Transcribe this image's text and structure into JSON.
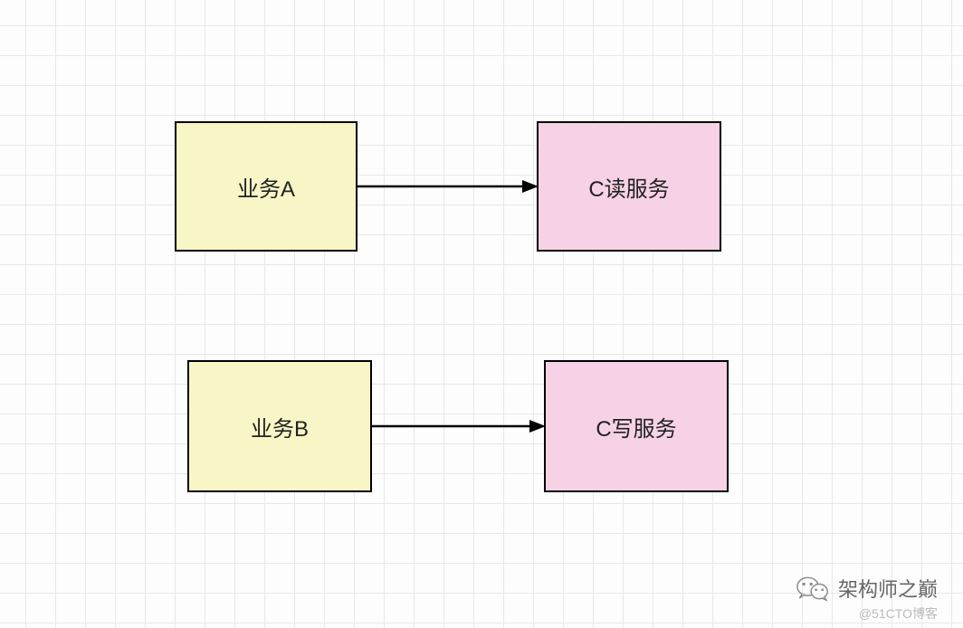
{
  "nodes": {
    "a": {
      "label": "业务A"
    },
    "b": {
      "label": "业务B"
    },
    "c_read": {
      "label": "C读服务"
    },
    "c_write": {
      "label": "C写服务"
    }
  },
  "watermark": {
    "main": "架构师之巅",
    "sub": "@51CTO博客"
  }
}
